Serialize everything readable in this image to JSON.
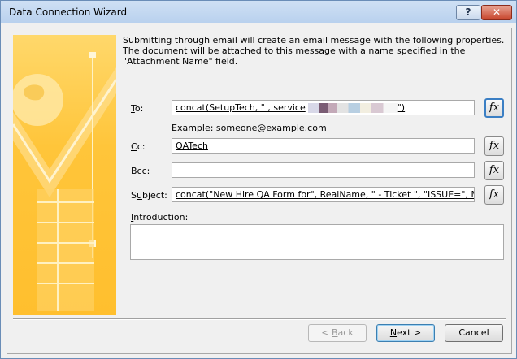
{
  "window": {
    "title": "Data Connection Wizard",
    "help_label": "?",
    "close_label": "✕"
  },
  "description": "Submitting through email will create an email message with the following properties. The document will be attached to this message with a name specified in the \"Attachment Name\" field.",
  "fields": {
    "to": {
      "label_key": "T",
      "label_rest": "o:",
      "value": "concat(SetupTech, \" , service",
      "value_tail": "\")"
    },
    "example": "Example: someone@example.com",
    "cc": {
      "label_key": "C",
      "label_rest": "c:",
      "value": "QATech"
    },
    "bcc": {
      "label_key": "B",
      "label_rest": "cc:",
      "value": ""
    },
    "subject": {
      "label_pre": "S",
      "label_key": "u",
      "label_rest": "bject:",
      "value": "concat(\"New Hire QA Form for\", RealName, \" - Ticket \", \"ISSUE=\", MasterT"
    },
    "introduction": {
      "label_key": "I",
      "label_rest": "ntroduction:",
      "value": ""
    },
    "fx_label": "fx"
  },
  "buttons": {
    "back_arrow": "< ",
    "back_key": "B",
    "back_rest": "ack",
    "next_key": "N",
    "next_rest": "ext >",
    "cancel": "Cancel"
  },
  "colors": {
    "banner": "#ffc53a",
    "title_bar": "#c5daf2",
    "close_button": "#c7452c"
  }
}
